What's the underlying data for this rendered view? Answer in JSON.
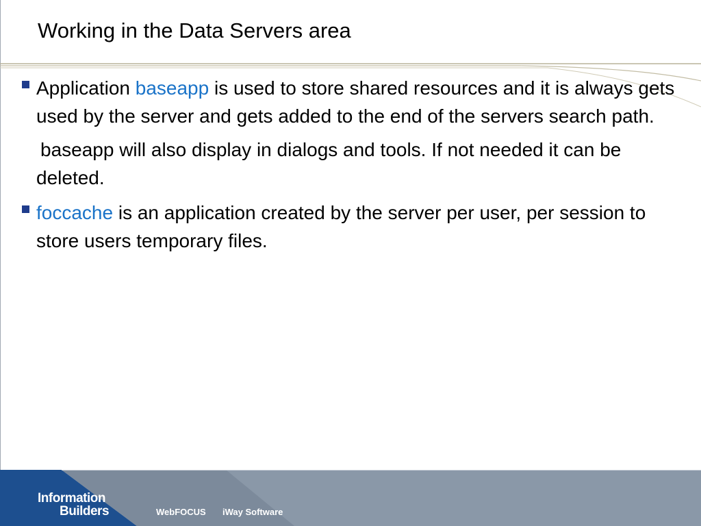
{
  "slide": {
    "title": "Working in the Data Servers area",
    "bullets": [
      {
        "parts": [
          {
            "text": "Application ",
            "highlight": false
          },
          {
            "text": "baseapp",
            "highlight": true
          },
          {
            "text": " is used to store shared resources and it is always gets used by the server and gets added to the end of the servers search path.",
            "highlight": false
          }
        ],
        "continuation": "baseapp will also display in dialogs and tools. If not needed it can be deleted."
      },
      {
        "parts": [
          {
            "text": "foccache",
            "highlight": true
          },
          {
            "text": " is an application created by the server per user, per session to store users temporary files.",
            "highlight": false
          }
        ]
      }
    ]
  },
  "footer": {
    "logo_line1": "Information",
    "logo_line2": "Builders",
    "links": [
      "WebFOCUS",
      "iWay Software"
    ]
  },
  "colors": {
    "highlight": "#1a73c8",
    "bullet": "#1f3c8c",
    "footer_dark": "#1d4f8f",
    "footer_gray": "#8a98a8"
  }
}
